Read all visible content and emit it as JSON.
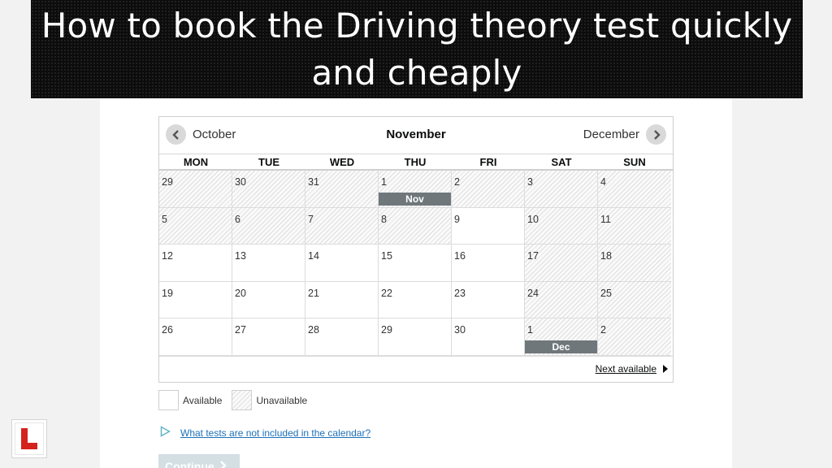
{
  "banner": {
    "title": "How to book the Driving theory test quickly and cheaply"
  },
  "calendar": {
    "prev_label": "October",
    "current_label": "November",
    "next_label": "December",
    "weekdays": [
      "MON",
      "TUE",
      "WED",
      "THU",
      "FRI",
      "SAT",
      "SUN"
    ],
    "days": [
      {
        "n": "29",
        "available": false
      },
      {
        "n": "30",
        "available": false
      },
      {
        "n": "31",
        "available": false
      },
      {
        "n": "1",
        "available": false,
        "tag": "Nov"
      },
      {
        "n": "2",
        "available": false
      },
      {
        "n": "3",
        "available": false
      },
      {
        "n": "4",
        "available": false
      },
      {
        "n": "5",
        "available": false
      },
      {
        "n": "6",
        "available": false
      },
      {
        "n": "7",
        "available": false
      },
      {
        "n": "8",
        "available": false
      },
      {
        "n": "9",
        "available": true
      },
      {
        "n": "10",
        "available": false
      },
      {
        "n": "11",
        "available": false
      },
      {
        "n": "12",
        "available": true
      },
      {
        "n": "13",
        "available": true
      },
      {
        "n": "14",
        "available": true
      },
      {
        "n": "15",
        "available": true
      },
      {
        "n": "16",
        "available": true
      },
      {
        "n": "17",
        "available": false
      },
      {
        "n": "18",
        "available": false
      },
      {
        "n": "19",
        "available": true
      },
      {
        "n": "20",
        "available": true
      },
      {
        "n": "21",
        "available": true
      },
      {
        "n": "22",
        "available": true
      },
      {
        "n": "23",
        "available": true
      },
      {
        "n": "24",
        "available": false
      },
      {
        "n": "25",
        "available": false
      },
      {
        "n": "26",
        "available": true
      },
      {
        "n": "27",
        "available": true
      },
      {
        "n": "28",
        "available": true
      },
      {
        "n": "29",
        "available": true
      },
      {
        "n": "30",
        "available": true
      },
      {
        "n": "1",
        "available": false,
        "tag": "Dec"
      },
      {
        "n": "2",
        "available": false
      }
    ],
    "next_available_label": "Next available"
  },
  "legend": {
    "available_label": "Available",
    "unavailable_label": "Unavailable"
  },
  "details": {
    "link_text": "What tests are not included in the calendar?"
  },
  "continue": {
    "label": "Continue"
  },
  "colors": {
    "banner_bg": "#0c0c0c",
    "month_tag": "#6f777b",
    "link": "#1d70b8",
    "logo_red": "#d4221c"
  },
  "icons": {
    "prev": "chevron-left-icon",
    "next": "chevron-right-icon",
    "next_available": "triangle-right-icon",
    "details": "triangle-outline-icon",
    "continue": "chevron-right-icon",
    "logo": "learner-plate-logo"
  }
}
